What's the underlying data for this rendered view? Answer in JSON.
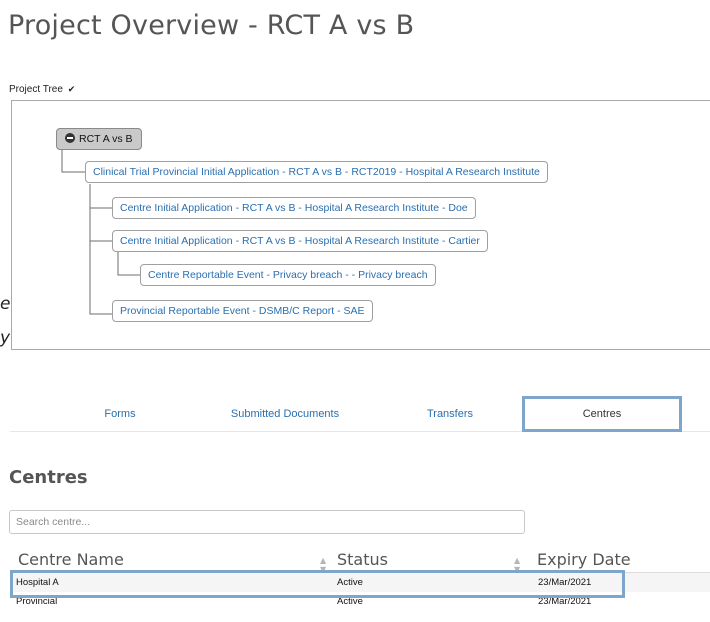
{
  "page_title": "Project Overview - RCT A vs B",
  "project_tree": {
    "toggle_label": "Project Tree",
    "root": "RCT A vs B",
    "nodes": [
      "Clinical Trial Provincial Initial Application - RCT A vs B - RCT2019 - Hospital A Research Institute",
      "Centre Initial Application - RCT A vs B - Hospital A Research Institute - Doe",
      "Centre Initial Application - RCT A vs B - Hospital A Research Institute - Cartier",
      "Centre Reportable Event - Privacy breach - - Privacy breach",
      "Provincial Reportable Event - DSMB/C Report - SAE"
    ]
  },
  "overlay_fragments": [
    "e",
    "y"
  ],
  "tabs": {
    "forms": "Forms",
    "submitted": "Submitted Documents",
    "transfers": "Transfers",
    "centres": "Centres",
    "active": "Centres"
  },
  "centres": {
    "title": "Centres",
    "search_placeholder": "Search centre...",
    "columns": {
      "name": "Centre Name",
      "status": "Status",
      "expiry": "Expiry Date"
    },
    "rows": [
      {
        "name": "Hospital A",
        "status": "Active",
        "expiry": "23/Mar/2021"
      },
      {
        "name": "Provincial",
        "status": "Active",
        "expiry": "23/Mar/2021"
      }
    ]
  },
  "colors": {
    "link": "#2a6fb0",
    "highlight": "#7ea5cc",
    "root_node_bg": "#c9c9c9"
  },
  "icons": {
    "tree_toggle": "chevron-down-icon",
    "root_collapse": "minus-circle-icon",
    "sort": "sort-icon"
  }
}
